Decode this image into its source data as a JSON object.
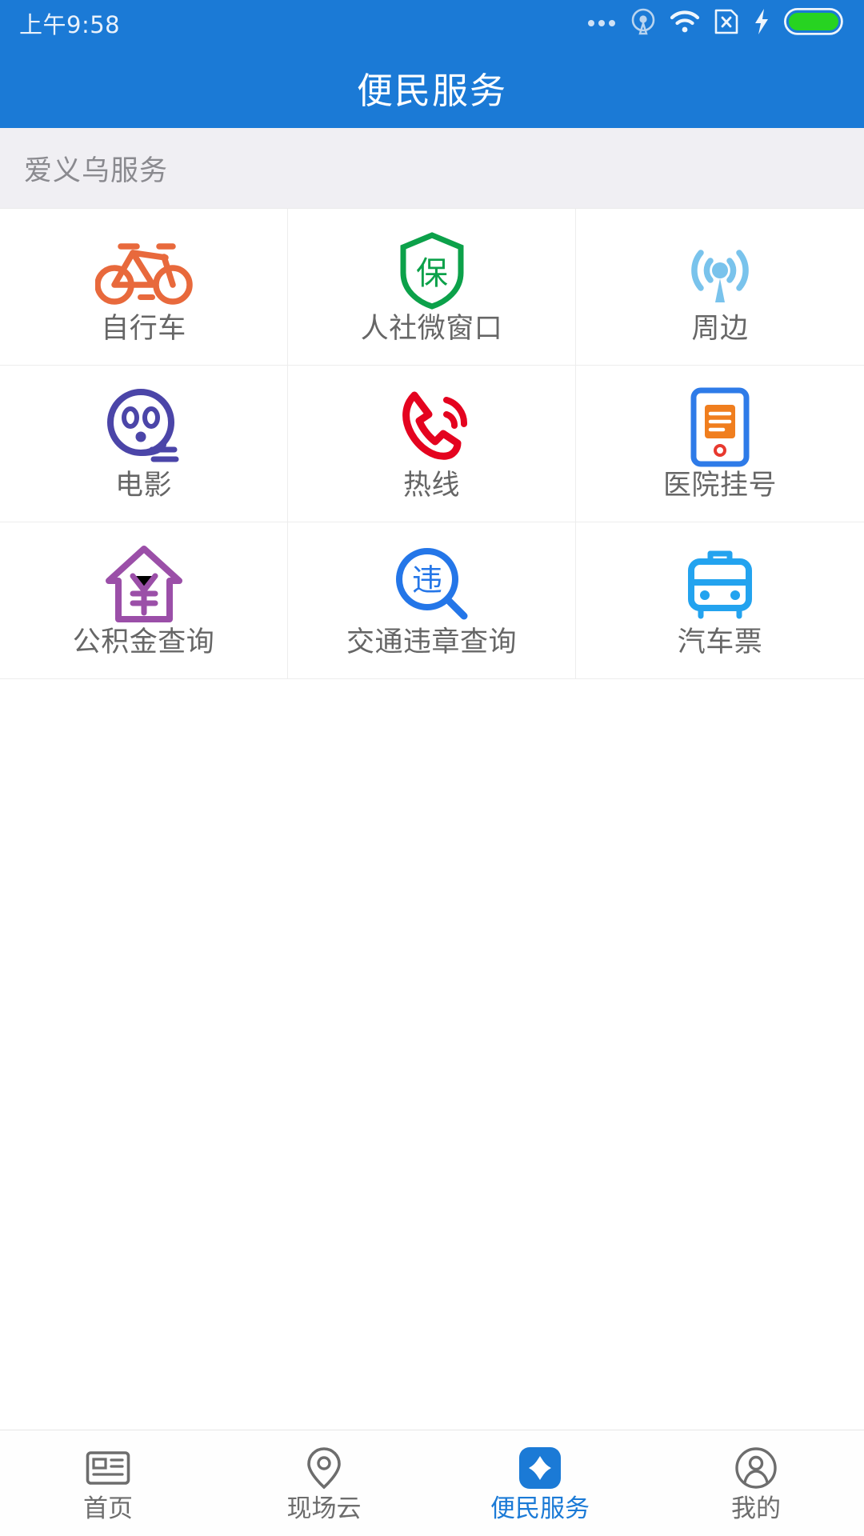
{
  "status_bar": {
    "time": "上午9:58",
    "icons": [
      "more-dots-icon",
      "location-gps-icon",
      "wifi-icon",
      "sim-no-card-icon",
      "charging-bolt-icon",
      "battery-full-icon"
    ]
  },
  "header": {
    "title": "便民服务",
    "background": "#1B7AD6"
  },
  "section": {
    "title": "爱义乌服务",
    "background": "#f0eff3"
  },
  "grid": {
    "items": [
      {
        "label": "自行车",
        "icon": "bicycle-icon",
        "color": "#E8693C"
      },
      {
        "label": "人社微窗口",
        "icon": "shield-insurance-icon",
        "color": "#0CA14A"
      },
      {
        "label": "周边",
        "icon": "signal-radar-icon",
        "color": "#79C3EC"
      },
      {
        "label": "电影",
        "icon": "film-reel-icon",
        "color": "#4B45A8"
      },
      {
        "label": "热线",
        "icon": "phone-hotline-icon",
        "color": "#E4031F"
      },
      {
        "label": "医院挂号",
        "icon": "hospital-register-icon",
        "color": "#2E7BE8"
      },
      {
        "label": "公积金查询",
        "icon": "house-yuan-icon",
        "color": "#9B4FA8"
      },
      {
        "label": "交通违章查询",
        "icon": "traffic-violation-search-icon",
        "color": "#2476E8"
      },
      {
        "label": "汽车票",
        "icon": "bus-ticket-icon",
        "color": "#23A3EF"
      }
    ]
  },
  "tabbar": {
    "active_color": "#1B7AD6",
    "inactive_color": "#6d6d6d",
    "items": [
      {
        "label": "首页",
        "icon": "newspaper-home-icon",
        "active": false
      },
      {
        "label": "现场云",
        "icon": "location-pin-icon",
        "active": false
      },
      {
        "label": "便民服务",
        "icon": "service-diamond-icon",
        "active": true
      },
      {
        "label": "我的",
        "icon": "user-profile-icon",
        "active": false
      }
    ]
  }
}
